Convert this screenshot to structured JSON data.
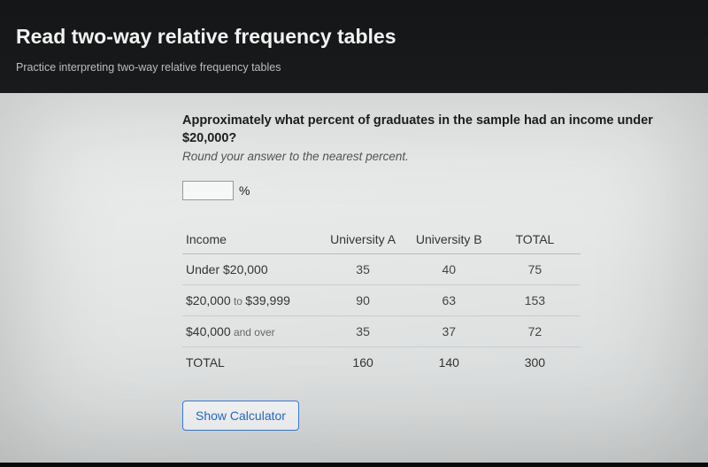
{
  "header": {
    "title": "Read two-way relative frequency tables",
    "subtitle": "Practice interpreting two-way relative frequency tables"
  },
  "question": {
    "prompt": "Approximately what percent of graduates in the sample had an income under $20,000?",
    "hint": "Round your answer to the nearest percent.",
    "unit": "%",
    "input_value": ""
  },
  "table": {
    "columns": [
      "Income",
      "University A",
      "University B",
      "TOTAL"
    ],
    "rows": [
      {
        "label": "Under $20,000",
        "a": 35,
        "b": 40,
        "total": 75
      },
      {
        "label_main": "$20,000",
        "label_join": " to ",
        "label_end": "$39,999",
        "a": 90,
        "b": 63,
        "total": 153
      },
      {
        "label_main": "$40,000",
        "label_suffix": " and over",
        "a": 35,
        "b": 37,
        "total": 72
      }
    ],
    "totals": {
      "label": "TOTAL",
      "a": 160,
      "b": 140,
      "total": 300
    }
  },
  "buttons": {
    "show_calculator": "Show Calculator"
  }
}
